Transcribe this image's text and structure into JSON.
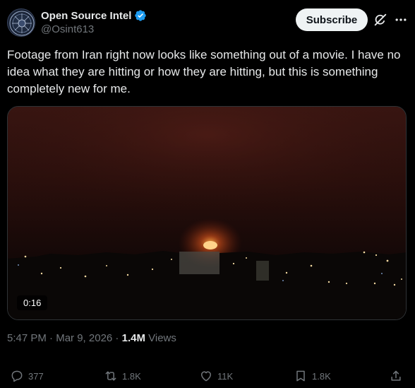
{
  "author": {
    "name": "Open Source Intel",
    "handle": "@Osint613"
  },
  "header": {
    "subscribe_label": "Subscribe",
    "icons": [
      "verified-badge-icon",
      "grok-icon",
      "more-icon"
    ]
  },
  "tweet": {
    "text": "Footage from Iran right now looks like something out of a movie. I have no idea what they are hitting or how they are hitting, but this is something completely new for me."
  },
  "media": {
    "duration": "0:16"
  },
  "meta": {
    "time": "5:47 PM",
    "separator1": " · ",
    "date": "Mar 9, 2026",
    "separator2": " · ",
    "views_count": "1.4M",
    "views_label": " Views"
  },
  "actions": {
    "replies": "377",
    "reposts": "1.8K",
    "likes": "11K",
    "bookmarks": "1.8K"
  },
  "colors": {
    "background": "#000000",
    "text_primary": "#e7e9ea",
    "text_secondary": "#71767b",
    "verified_blue": "#1d9bf0"
  }
}
